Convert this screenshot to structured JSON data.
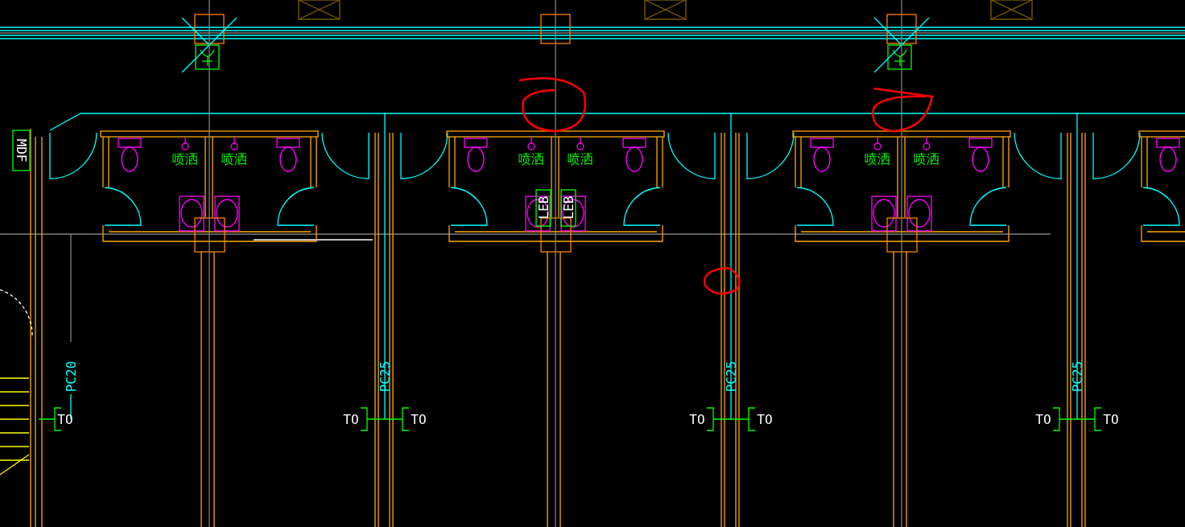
{
  "drawing": {
    "mdf_label": "MDF",
    "toilet_blocks": [
      {
        "fixture_labels": [
          "喷洒",
          "喷洒"
        ]
      },
      {
        "fixture_labels": [
          "喷洒",
          "喷洒"
        ],
        "panel_labels": [
          "LEB",
          "LEB"
        ]
      },
      {
        "fixture_labels": [
          "喷洒",
          "喷洒"
        ]
      }
    ],
    "outlet_groups": [
      {
        "cable": "PC20",
        "outlets": [
          "TO"
        ]
      },
      {
        "cable": "PC25",
        "outlets": [
          "TO",
          "TO"
        ]
      },
      {
        "cable": "PC25",
        "outlets": [
          "TO",
          "TO"
        ]
      },
      {
        "cable": "PC25",
        "outlets": [
          "TO",
          "TO"
        ]
      }
    ]
  }
}
